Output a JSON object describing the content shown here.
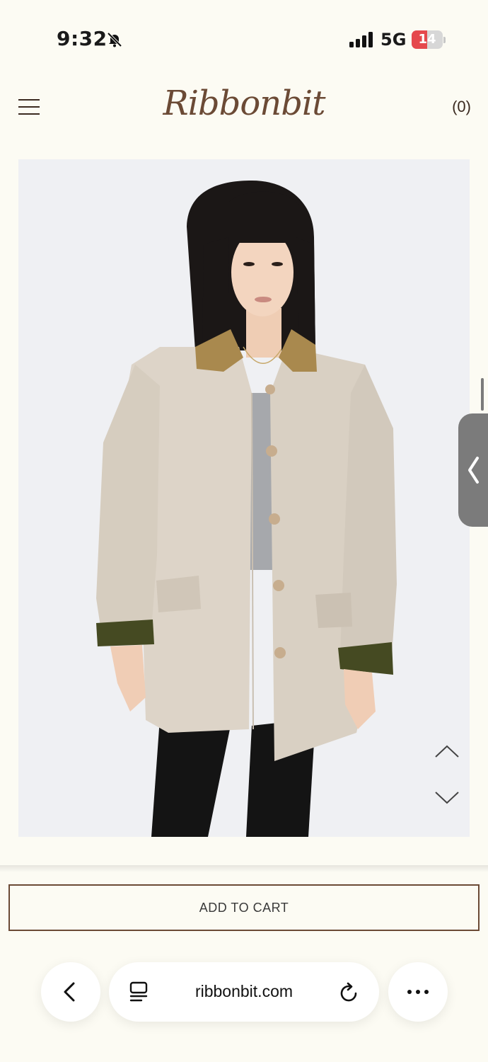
{
  "status_bar": {
    "time": "9:32",
    "network": "5G",
    "battery": "14",
    "battery_level": 0.14,
    "icons": [
      "bell-off-icon",
      "signal-icon",
      "battery-icon"
    ]
  },
  "header": {
    "logo": "Ribbonbit",
    "cart_count": "(0)",
    "icons": [
      "menu-icon"
    ]
  },
  "product": {
    "image_icons": [
      "arrow-up-icon",
      "arrow-down-icon"
    ],
    "add_to_cart": "ADD TO CART"
  },
  "browser": {
    "url": "ribbonbit.com",
    "icons": [
      "back-icon",
      "tabs-icon",
      "reload-icon",
      "more-icon",
      "side-panel-chevron-icon"
    ]
  },
  "colors": {
    "background": "#fcfbf3",
    "brand_brown": "#6b4a35",
    "battery_red": "#e5484d"
  }
}
